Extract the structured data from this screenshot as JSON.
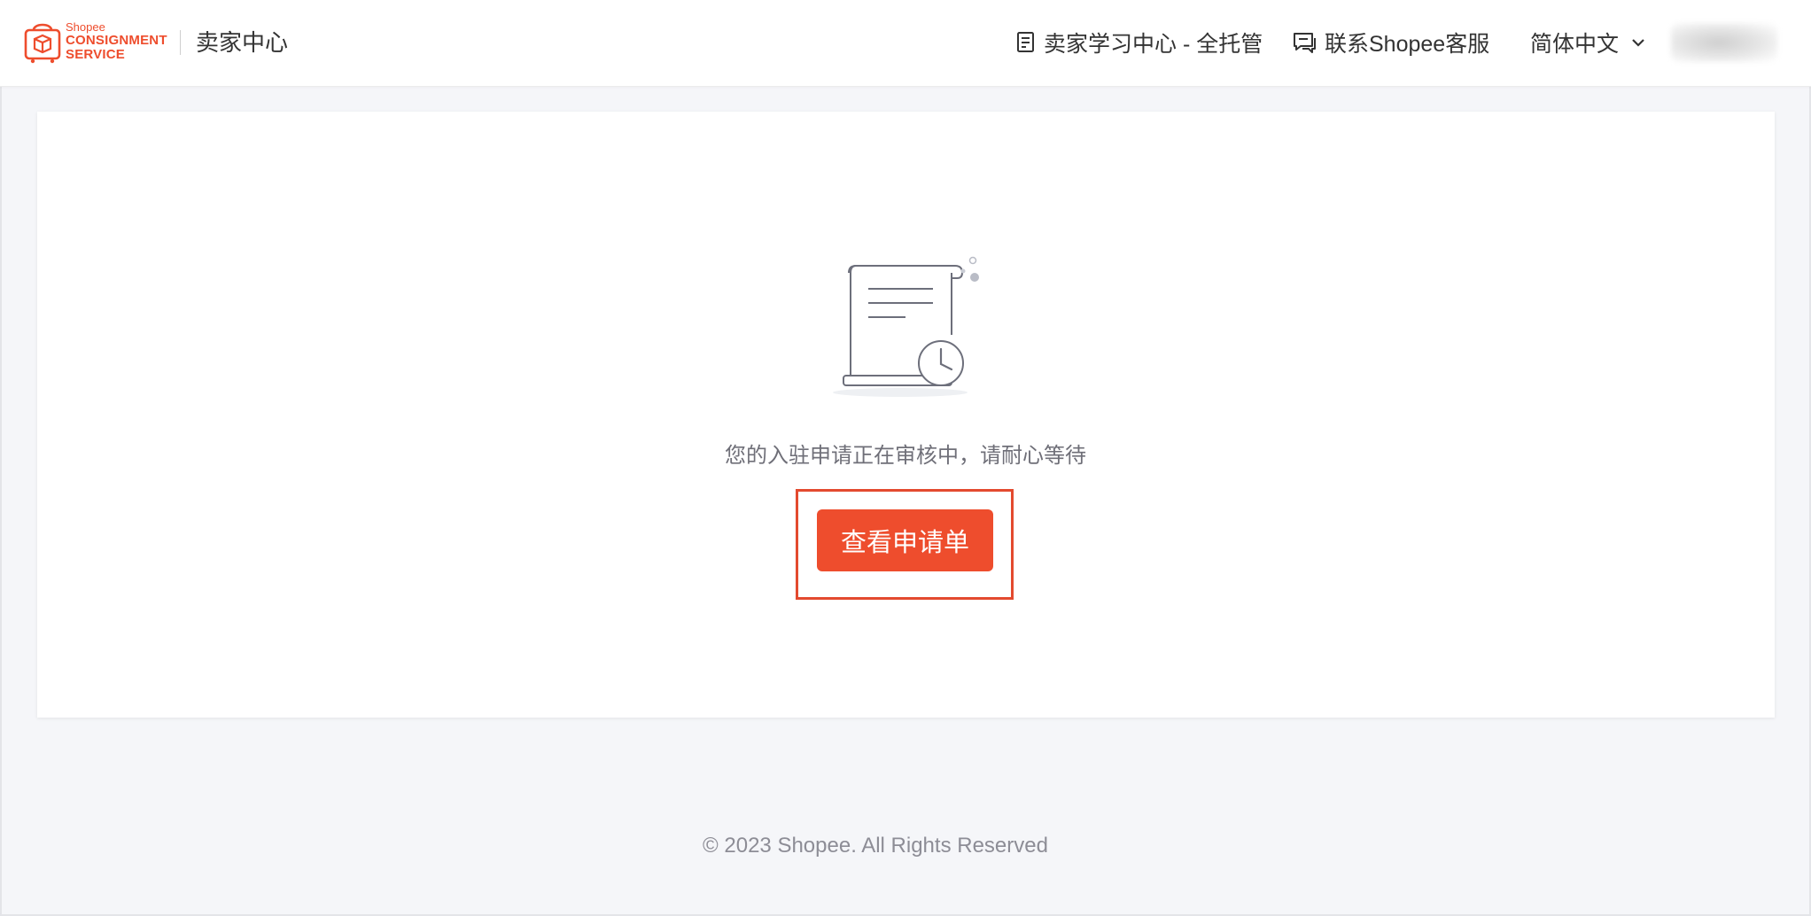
{
  "header": {
    "logo": {
      "brand_small": "Shopee",
      "brand_line1": "CONSIGNMENT",
      "brand_line2": "SERVICE",
      "accent_color": "#ee4d2d"
    },
    "title": "卖家中心",
    "nav": {
      "learning_center": {
        "label": "卖家学习中心 - 全托管",
        "icon": "document-icon"
      },
      "customer_service": {
        "label": "联系Shopee客服",
        "icon": "chat-icon"
      },
      "language": {
        "label": "简体中文",
        "icon": "chevron-down-icon"
      }
    }
  },
  "main": {
    "illustration_icon": "document-clock-icon",
    "status_text": "您的入驻申请正在审核中，请耐心等待",
    "primary_button_label": "查看申请单",
    "primary_color": "#ee4d2d"
  },
  "footer": {
    "copyright": "© 2023 Shopee. All Rights Reserved"
  }
}
